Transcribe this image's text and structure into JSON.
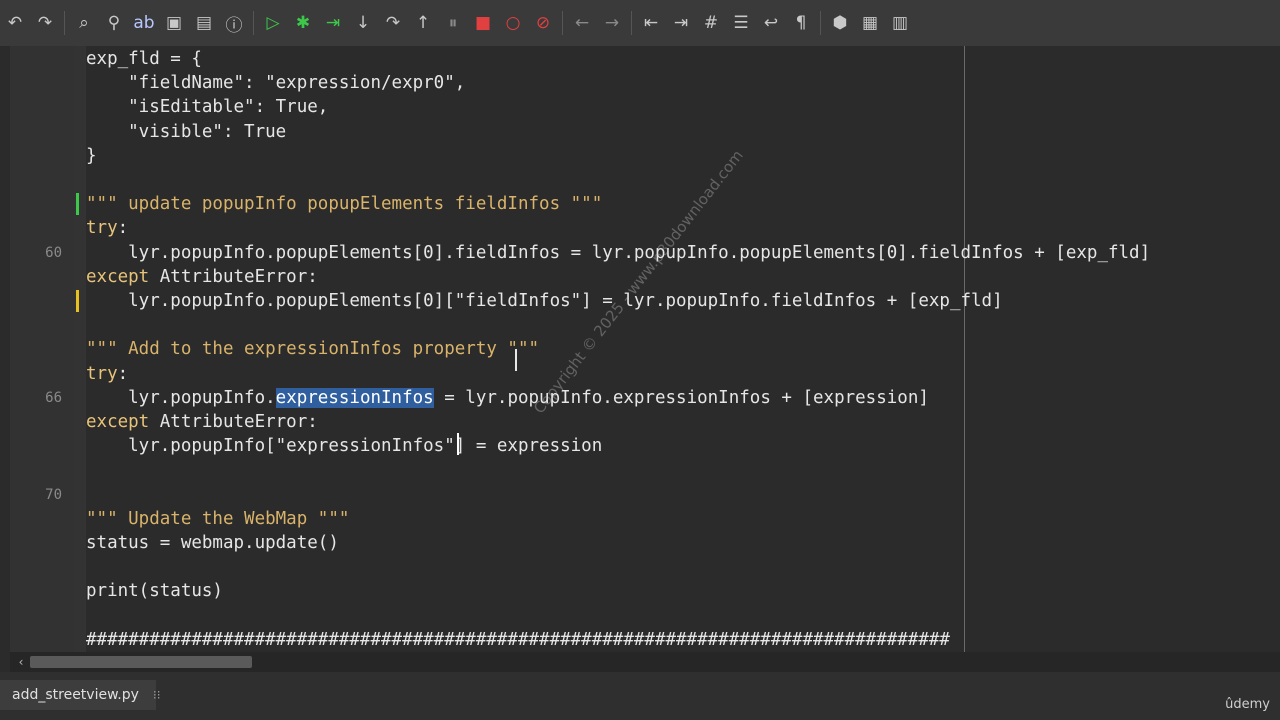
{
  "toolbar": {
    "buttons": [
      {
        "name": "undo-icon",
        "glyph": "↶"
      },
      {
        "name": "redo-icon",
        "glyph": "↷"
      },
      {
        "name": "search-icon",
        "glyph": "⌕"
      },
      {
        "name": "find-users-icon",
        "glyph": "⚲"
      },
      {
        "name": "replace-icon",
        "glyph": "ab"
      },
      {
        "name": "browse-icon",
        "glyph": "▣"
      },
      {
        "name": "image-icon",
        "glyph": "▤"
      },
      {
        "name": "info-icon",
        "glyph": "ⓘ"
      },
      {
        "name": "run-icon",
        "glyph": "▷"
      },
      {
        "name": "debug-icon",
        "glyph": "✱"
      },
      {
        "name": "run-to-cursor-icon",
        "glyph": "⇥"
      },
      {
        "name": "step-into-icon",
        "glyph": "↓"
      },
      {
        "name": "step-over-icon",
        "glyph": "↷"
      },
      {
        "name": "step-out-icon",
        "glyph": "↑"
      },
      {
        "name": "pause-icon",
        "glyph": "⏸"
      },
      {
        "name": "stop-icon",
        "glyph": "■"
      },
      {
        "name": "breakpoint-icon",
        "glyph": "○"
      },
      {
        "name": "clear-breakpoints-icon",
        "glyph": "⊘"
      },
      {
        "name": "back-icon",
        "glyph": "←"
      },
      {
        "name": "forward-icon",
        "glyph": "→"
      },
      {
        "name": "indent-icon",
        "glyph": "⇤"
      },
      {
        "name": "dedent-icon",
        "glyph": "⇥"
      },
      {
        "name": "comment-icon",
        "glyph": "#"
      },
      {
        "name": "list-icon",
        "glyph": "☰"
      },
      {
        "name": "wrap-icon",
        "glyph": "↩"
      },
      {
        "name": "pilcrow-icon",
        "glyph": "¶"
      },
      {
        "name": "python-icon",
        "glyph": "⬢"
      },
      {
        "name": "console-icon",
        "glyph": "▦"
      },
      {
        "name": "layout-icon",
        "glyph": "▥"
      }
    ]
  },
  "editor": {
    "lines": [
      {
        "num": "",
        "code": "exp_fld = {"
      },
      {
        "num": "",
        "code": "    \"fieldName\": \"expression/expr0\","
      },
      {
        "num": "",
        "code": "    \"isEditable\": True,"
      },
      {
        "num": "",
        "code": "    \"visible\": True"
      },
      {
        "num": "",
        "code": "}"
      },
      {
        "num": "",
        "code": ""
      },
      {
        "num": "",
        "code": "\"\"\" update popupInfo popupElements fieldInfos \"\"\""
      },
      {
        "num": "",
        "code": "try:"
      },
      {
        "num": "60",
        "code": "    lyr.popupInfo.popupElements[0].fieldInfos = lyr.popupInfo.popupElements[0].fieldInfos + [exp_fld]"
      },
      {
        "num": "",
        "code": "except AttributeError:"
      },
      {
        "num": "",
        "code": "    lyr.popupInfo.popupElements[0][\"fieldInfos\"] = lyr.popupInfo.fieldInfos + [exp_fld]"
      },
      {
        "num": "",
        "code": ""
      },
      {
        "num": "",
        "code": "\"\"\" Add to the expressionInfos property \"\"\""
      },
      {
        "num": "",
        "code": "try:"
      },
      {
        "num": "66",
        "code": "    lyr.popupInfo.expressionInfos = lyr.popupInfo.expressionInfos + [expression]"
      },
      {
        "num": "",
        "code": "except AttributeError:"
      },
      {
        "num": "",
        "code": "    lyr.popupInfo[\"expressionInfos\"] = expression"
      },
      {
        "num": "",
        "code": ""
      },
      {
        "num": "70",
        "code": ""
      },
      {
        "num": "",
        "code": "\"\"\" Update the WebMap \"\"\""
      },
      {
        "num": "",
        "code": "status = webmap.update()"
      },
      {
        "num": "",
        "code": ""
      },
      {
        "num": "",
        "code": "print(status)"
      },
      {
        "num": "",
        "code": ""
      },
      {
        "num": "",
        "code": "##################################################################################"
      }
    ],
    "selected_text": "expressionInfos"
  },
  "tab": {
    "label": "add_streetview.py",
    "close": "⁝⁝"
  },
  "brand": "ûdemy",
  "watermark": "Copyright © 2025 - www.p30download.com"
}
